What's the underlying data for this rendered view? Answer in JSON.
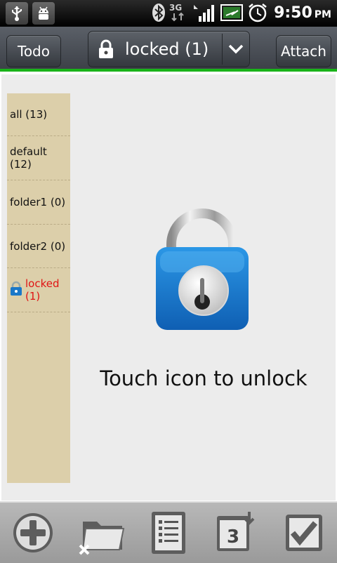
{
  "status_bar": {
    "time": "9:50",
    "ampm": "PM",
    "network": "3G",
    "icons": [
      "usb-icon",
      "android-debug-icon",
      "bluetooth-icon",
      "signal-icon",
      "battery-charging-icon",
      "alarm-clock-icon"
    ]
  },
  "titlebar": {
    "left_button": "Todo",
    "title": "locked (1)",
    "right_button": "Attach"
  },
  "sidebar": {
    "items": [
      {
        "label": "all (13)"
      },
      {
        "label": "default (12)"
      },
      {
        "label": "folder1 (0)"
      },
      {
        "label": "folder2 (0)"
      },
      {
        "label": "locked (1)"
      }
    ]
  },
  "main": {
    "unlock_text": "Touch icon to unlock"
  },
  "bottombar": {
    "calendar_day": "3",
    "icons": [
      "add-icon",
      "folder-delete-icon",
      "list-icon",
      "calendar-icon",
      "checkbox-icon"
    ]
  },
  "colors": {
    "accent_green": "#19b319",
    "sidebar_bg": "#dccfaa",
    "locked_red": "#e01414",
    "lock_blue": "#1a78c8"
  }
}
